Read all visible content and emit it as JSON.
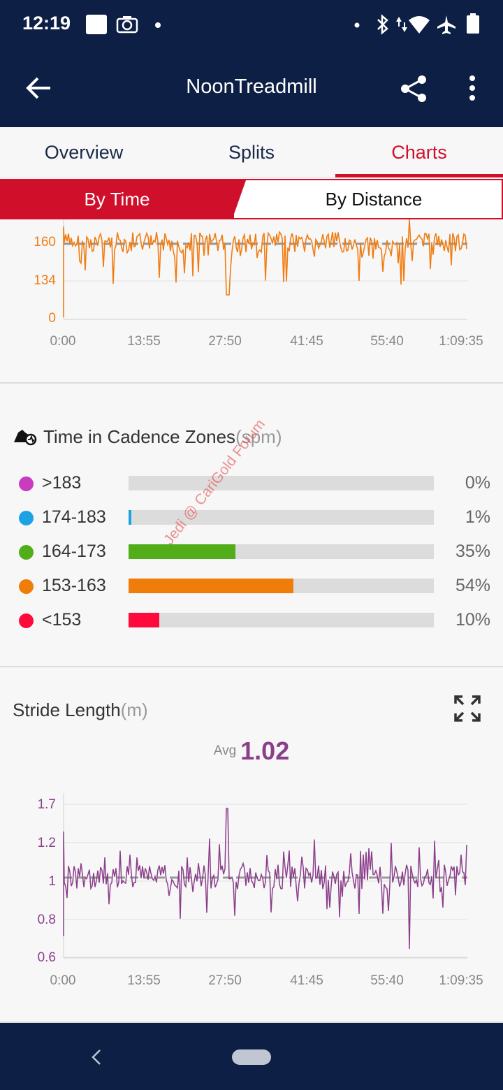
{
  "status_bar": {
    "time": "12:19",
    "icons": [
      "square-notification-icon",
      "camera-icon",
      "dot-icon",
      "dot-icon",
      "bluetooth-icon",
      "data-arrows-icon",
      "wifi-icon",
      "airplane-icon",
      "battery-icon"
    ]
  },
  "app_bar": {
    "title": "NoonTreadmill",
    "back_icon": "arrow-left-icon",
    "share_icon": "share-icon",
    "more_icon": "more-vert-icon"
  },
  "tabs": [
    {
      "label": "Overview",
      "active": false
    },
    {
      "label": "Splits",
      "active": false
    },
    {
      "label": "Charts",
      "active": true
    }
  ],
  "segment": {
    "left_label": "By Time",
    "right_label": "By Distance",
    "selected": "By Time"
  },
  "cadence_chart": {
    "y_ticks": [
      "160",
      "134",
      "0"
    ],
    "x_ticks": [
      "0:00",
      "13:55",
      "27:50",
      "41:45",
      "55:40",
      "1:09:35"
    ],
    "color": "#f07d14",
    "avg_line_color": "#999999"
  },
  "cadence_zones": {
    "title": "Time in Cadence Zones",
    "unit": "(spm)",
    "icon": "running-shoe-icon",
    "zones": [
      {
        "label": ">183",
        "percent_text": "0%",
        "fraction": 0.0,
        "color": "#c93cbf"
      },
      {
        "label": "174-183",
        "percent_text": "1%",
        "fraction": 0.01,
        "color": "#1ca3e4"
      },
      {
        "label": "164-173",
        "percent_text": "35%",
        "fraction": 0.35,
        "color": "#52ad1a"
      },
      {
        "label": "153-163",
        "percent_text": "54%",
        "fraction": 0.54,
        "color": "#f07d0a"
      },
      {
        "label": "<153",
        "percent_text": "10%",
        "fraction": 0.1,
        "color": "#ff0a3c"
      }
    ],
    "watermark": "Jedi @ CariGold Forum"
  },
  "stride_length": {
    "title": "Stride Length",
    "unit": "(m)",
    "expand_icon": "expand-icon",
    "avg_label": "Avg",
    "avg_value": "1.02",
    "y_ticks": [
      "1.7",
      "1.2",
      "1",
      "0.8",
      "0.6"
    ],
    "x_ticks": [
      "0:00",
      "13:55",
      "27:50",
      "41:45",
      "55:40",
      "1:09:35"
    ],
    "color": "#8b3f8b"
  },
  "nav_bar": {
    "back_icon": "chevron-left-icon",
    "home_icon": "home-pill-icon"
  }
}
